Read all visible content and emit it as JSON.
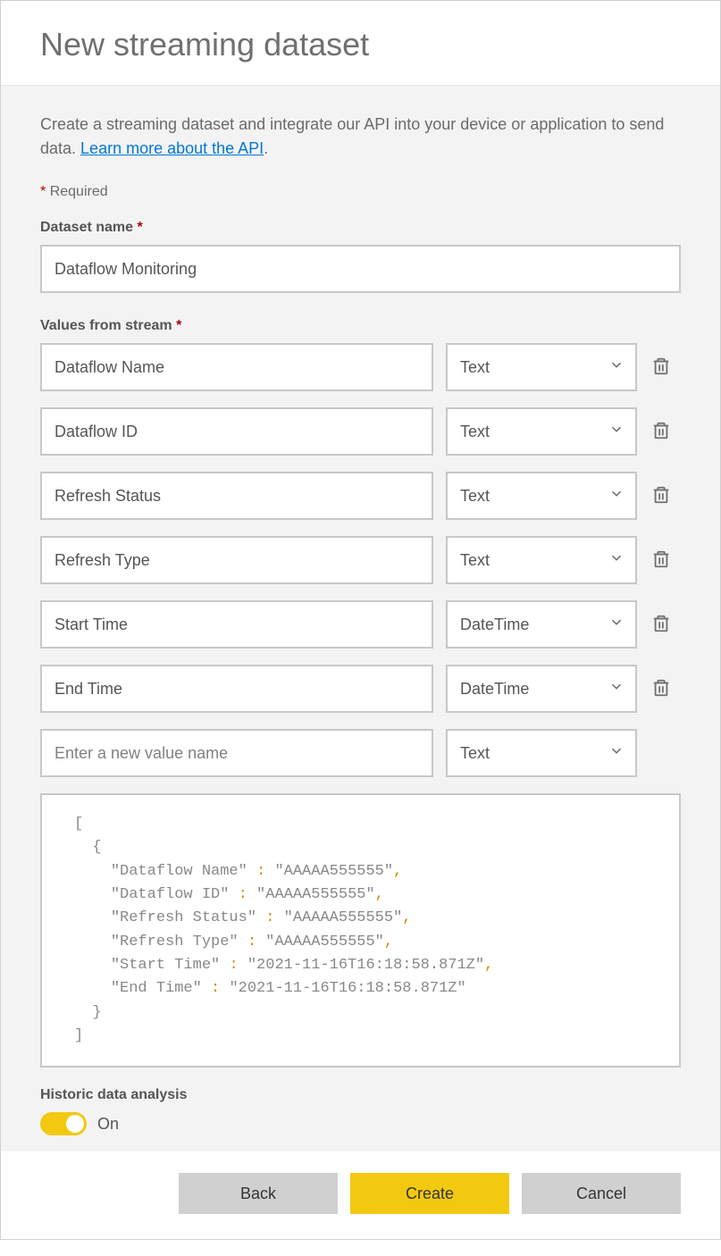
{
  "header": {
    "title": "New streaming dataset"
  },
  "intro": {
    "text_before": "Create a streaming dataset and integrate our API into your device or application to send data. ",
    "link_text": "Learn more about the API",
    "text_after": "."
  },
  "required_note": "Required",
  "dataset_name": {
    "label": "Dataset name",
    "value": "Dataflow Monitoring"
  },
  "values_from_stream": {
    "label": "Values from stream",
    "rows": [
      {
        "name": "Dataflow Name",
        "type": "Text"
      },
      {
        "name": "Dataflow ID",
        "type": "Text"
      },
      {
        "name": "Refresh Status",
        "type": "Text"
      },
      {
        "name": "Refresh Type",
        "type": "Text"
      },
      {
        "name": "Start Time",
        "type": "DateTime"
      },
      {
        "name": "End Time",
        "type": "DateTime"
      }
    ],
    "new_row": {
      "placeholder": "Enter a new value name",
      "type": "Text"
    }
  },
  "preview_fields": [
    {
      "key": "Dataflow Name",
      "value": "AAAAA555555"
    },
    {
      "key": "Dataflow ID",
      "value": "AAAAA555555"
    },
    {
      "key": "Refresh Status",
      "value": "AAAAA555555"
    },
    {
      "key": "Refresh Type",
      "value": "AAAAA555555"
    },
    {
      "key": "Start Time",
      "value": "2021-11-16T16:18:58.871Z"
    },
    {
      "key": "End Time",
      "value": "2021-11-16T16:18:58.871Z"
    }
  ],
  "historic": {
    "label": "Historic data analysis",
    "state": "On"
  },
  "footer": {
    "back": "Back",
    "create": "Create",
    "cancel": "Cancel"
  }
}
